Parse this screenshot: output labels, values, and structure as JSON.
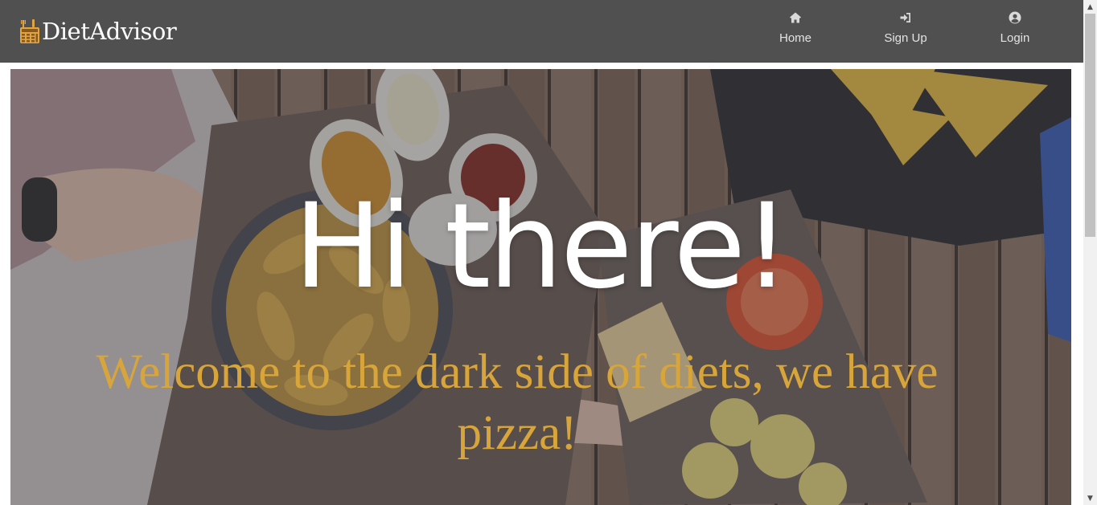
{
  "navbar": {
    "brand_name": "DietAdvisor",
    "brand_icon": "calculator-fork-logo-icon",
    "items": [
      {
        "label": "Home",
        "icon": "home-icon"
      },
      {
        "label": "Sign Up",
        "icon": "sign-in-icon"
      },
      {
        "label": "Login",
        "icon": "user-circle-icon"
      }
    ]
  },
  "hero": {
    "title": "Hi there!",
    "subtitle": "Welcome to the dark side of diets, we have pizza!",
    "background_image": "food-table-photo"
  },
  "colors": {
    "navbar_background": "#505050",
    "subtitle_accent": "#d8a53a",
    "title_text": "#ffffff"
  }
}
